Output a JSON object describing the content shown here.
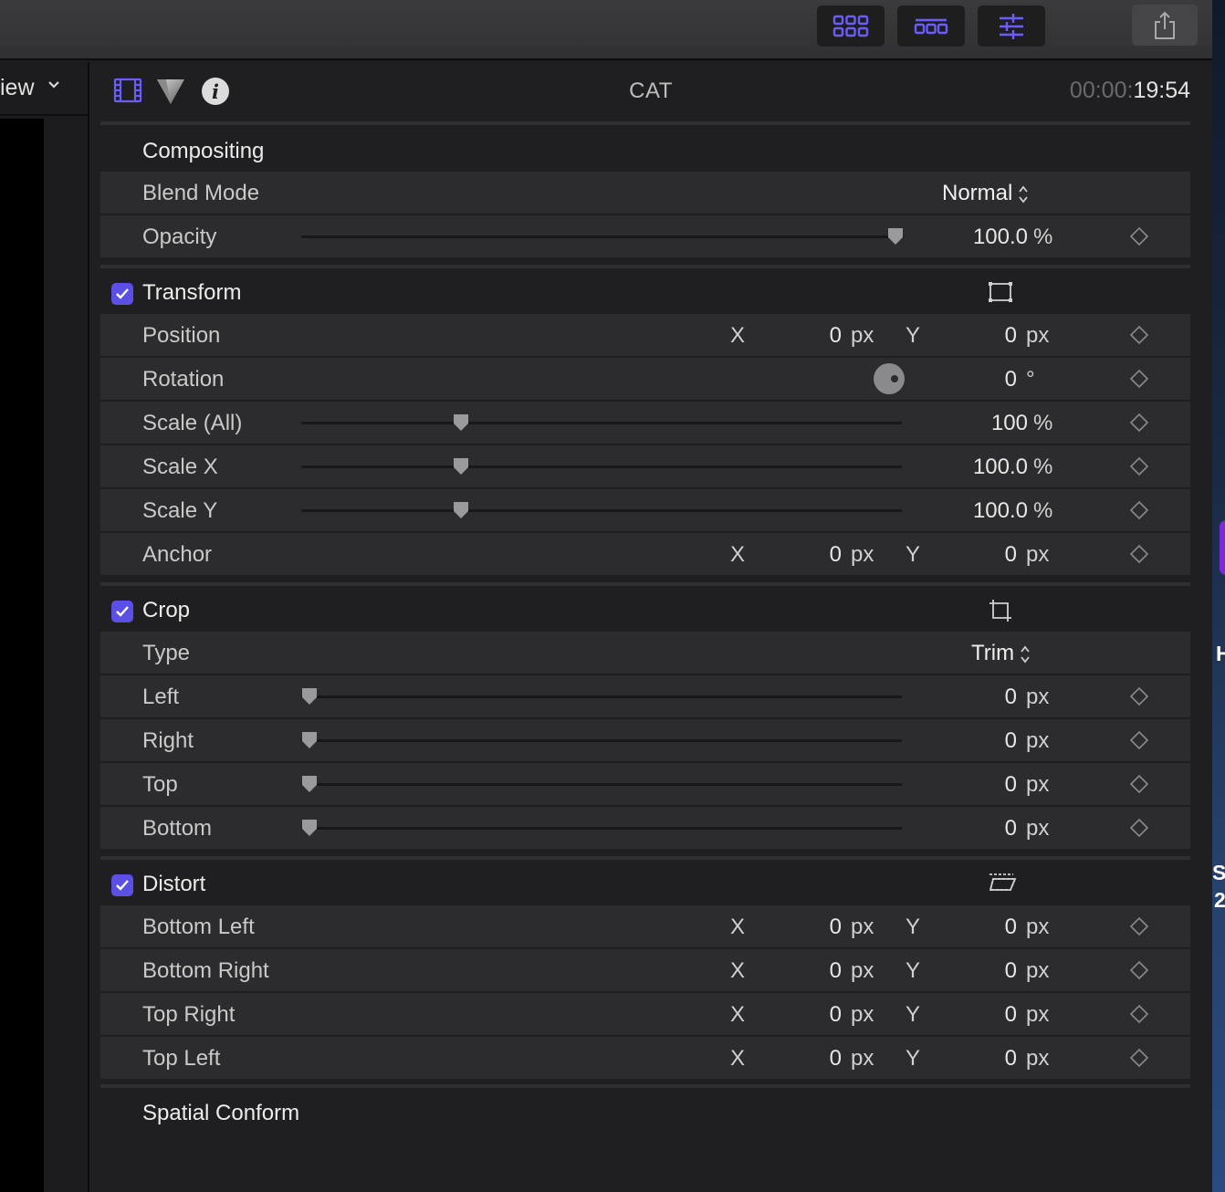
{
  "toolbar": {
    "buttons": [
      {
        "name": "browser-grid-icon"
      },
      {
        "name": "timeline-clips-icon"
      },
      {
        "name": "inspector-sliders-icon"
      }
    ],
    "share_icon": "share-icon",
    "accent_color": "#5b4fe6"
  },
  "viewer": {
    "view_label": "iew"
  },
  "inspector": {
    "tabs": [
      "video-inspector-icon",
      "color-inspector-icon",
      "info-inspector-icon"
    ],
    "clip_name": "CAT",
    "timecode_dim": "00:00:",
    "timecode_bright": "19:54"
  },
  "compositing": {
    "title": "Compositing",
    "blend_mode": {
      "label": "Blend Mode",
      "value": "Normal"
    },
    "opacity": {
      "label": "Opacity",
      "value": "100.0",
      "unit": "%",
      "slider_fraction": 1.0
    }
  },
  "transform": {
    "title": "Transform",
    "enabled": true,
    "position": {
      "label": "Position",
      "x_axis": "X",
      "x": "0",
      "x_unit": "px",
      "y_axis": "Y",
      "y": "0",
      "y_unit": "px"
    },
    "rotation": {
      "label": "Rotation",
      "value": "0",
      "unit": "°"
    },
    "scale_all": {
      "label": "Scale (All)",
      "value": "100",
      "unit": "%",
      "slider_fraction": 0.26
    },
    "scale_x": {
      "label": "Scale X",
      "value": "100.0",
      "unit": "%",
      "slider_fraction": 0.26
    },
    "scale_y": {
      "label": "Scale Y",
      "value": "100.0",
      "unit": "%",
      "slider_fraction": 0.26
    },
    "anchor": {
      "label": "Anchor",
      "x_axis": "X",
      "x": "0",
      "x_unit": "px",
      "y_axis": "Y",
      "y": "0",
      "y_unit": "px"
    }
  },
  "crop": {
    "title": "Crop",
    "enabled": true,
    "type": {
      "label": "Type",
      "value": "Trim"
    },
    "left": {
      "label": "Left",
      "value": "0",
      "unit": "px",
      "slider_fraction": 0
    },
    "right": {
      "label": "Right",
      "value": "0",
      "unit": "px",
      "slider_fraction": 0
    },
    "top": {
      "label": "Top",
      "value": "0",
      "unit": "px",
      "slider_fraction": 0
    },
    "bottom": {
      "label": "Bottom",
      "value": "0",
      "unit": "px",
      "slider_fraction": 0
    }
  },
  "distort": {
    "title": "Distort",
    "enabled": true,
    "rows": [
      {
        "label": "Bottom Left",
        "x_axis": "X",
        "x": "0",
        "x_unit": "px",
        "y_axis": "Y",
        "y": "0",
        "y_unit": "px"
      },
      {
        "label": "Bottom Right",
        "x_axis": "X",
        "x": "0",
        "x_unit": "px",
        "y_axis": "Y",
        "y": "0",
        "y_unit": "px"
      },
      {
        "label": "Top Right",
        "x_axis": "X",
        "x": "0",
        "x_unit": "px",
        "y_axis": "Y",
        "y": "0",
        "y_unit": "px"
      },
      {
        "label": "Top Left",
        "x_axis": "X",
        "x": "0",
        "x_unit": "px",
        "y_axis": "Y",
        "y": "0",
        "y_unit": "px"
      }
    ]
  },
  "spatial_conform": {
    "title": "Spatial Conform"
  },
  "desktop_edge": {
    "glyph_1": "H",
    "glyph_2": "S",
    "glyph_3": "2"
  }
}
